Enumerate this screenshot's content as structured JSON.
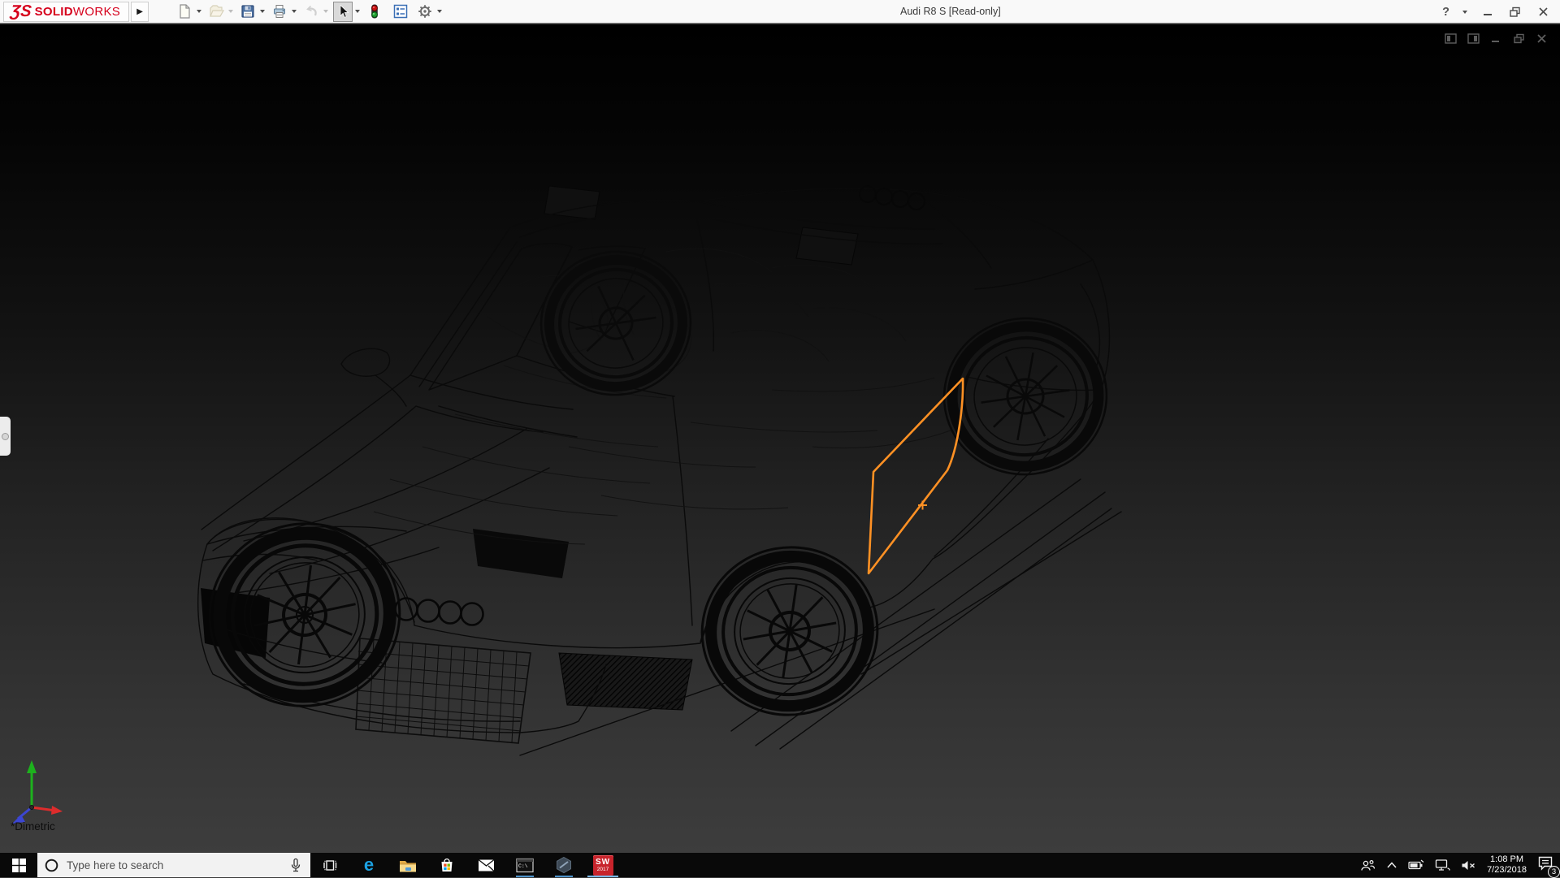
{
  "window": {
    "title": "Audi R8 S [Read-only]",
    "help_glyph": "?"
  },
  "brand": {
    "mark": "ƷS",
    "solid": "SOLID",
    "works": "WORKS",
    "color": "#d6001c"
  },
  "toolbar": {
    "icons": [
      {
        "name": "new-document-icon",
        "enabled": true,
        "dropdown": true,
        "active": false
      },
      {
        "name": "open-file-icon",
        "enabled": false,
        "dropdown": true,
        "active": false
      },
      {
        "name": "save-icon",
        "enabled": true,
        "dropdown": true,
        "active": false
      },
      {
        "name": "print-icon",
        "enabled": true,
        "dropdown": true,
        "active": false
      },
      {
        "name": "undo-icon",
        "enabled": false,
        "dropdown": true,
        "active": false
      },
      {
        "name": "select-cursor-icon",
        "enabled": true,
        "dropdown": true,
        "active": true
      },
      {
        "name": "rebuild-stoplight-icon",
        "enabled": true,
        "dropdown": false,
        "active": false
      },
      {
        "name": "task-pane-icon",
        "enabled": true,
        "dropdown": false,
        "active": false
      },
      {
        "name": "options-gear-icon",
        "enabled": true,
        "dropdown": true,
        "active": false
      }
    ]
  },
  "viewport": {
    "view_orientation": "*Dimetric",
    "selection_color": "#ff9124",
    "background_top": "#000000",
    "background_bottom": "#3d3d3d"
  },
  "taskbar": {
    "search": {
      "placeholder": "Type here to search"
    },
    "edge_glyph": "e",
    "cmd_icon_text": "C:\\",
    "apps": [
      "task-view",
      "edge",
      "file-explorer",
      "microsoft-store",
      "mail",
      "command-prompt",
      "composer-hexagon",
      "solidworks-2017"
    ],
    "solidworks_icon": {
      "text": "SW",
      "year": "2017"
    },
    "tray": {
      "time": "1:08 PM",
      "date": "7/23/2018",
      "notification_count": "3"
    }
  }
}
